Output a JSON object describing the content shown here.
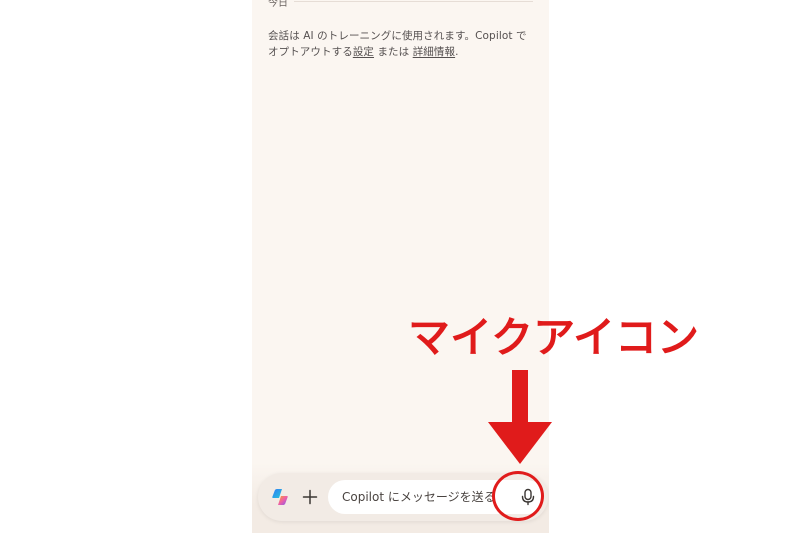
{
  "chat": {
    "date_label": "今日",
    "notice_text": "会話は AI のトレーニングに使用されます。Copilot でオプトアウトする",
    "settings_link": "設定",
    "notice_or": " または ",
    "details_link": "詳細情報",
    "notice_end": "."
  },
  "composer": {
    "logo_icon": "copilot-logo-icon",
    "plus_icon": "plus-icon",
    "placeholder": "Copilot にメッセージを送る",
    "mic_icon": "microphone-icon"
  },
  "annotation": {
    "label": "マイクアイコン",
    "color": "#e01b1b"
  },
  "colors": {
    "phone_background": "#fbf6f1",
    "composer_background": "#f2ebe5"
  }
}
